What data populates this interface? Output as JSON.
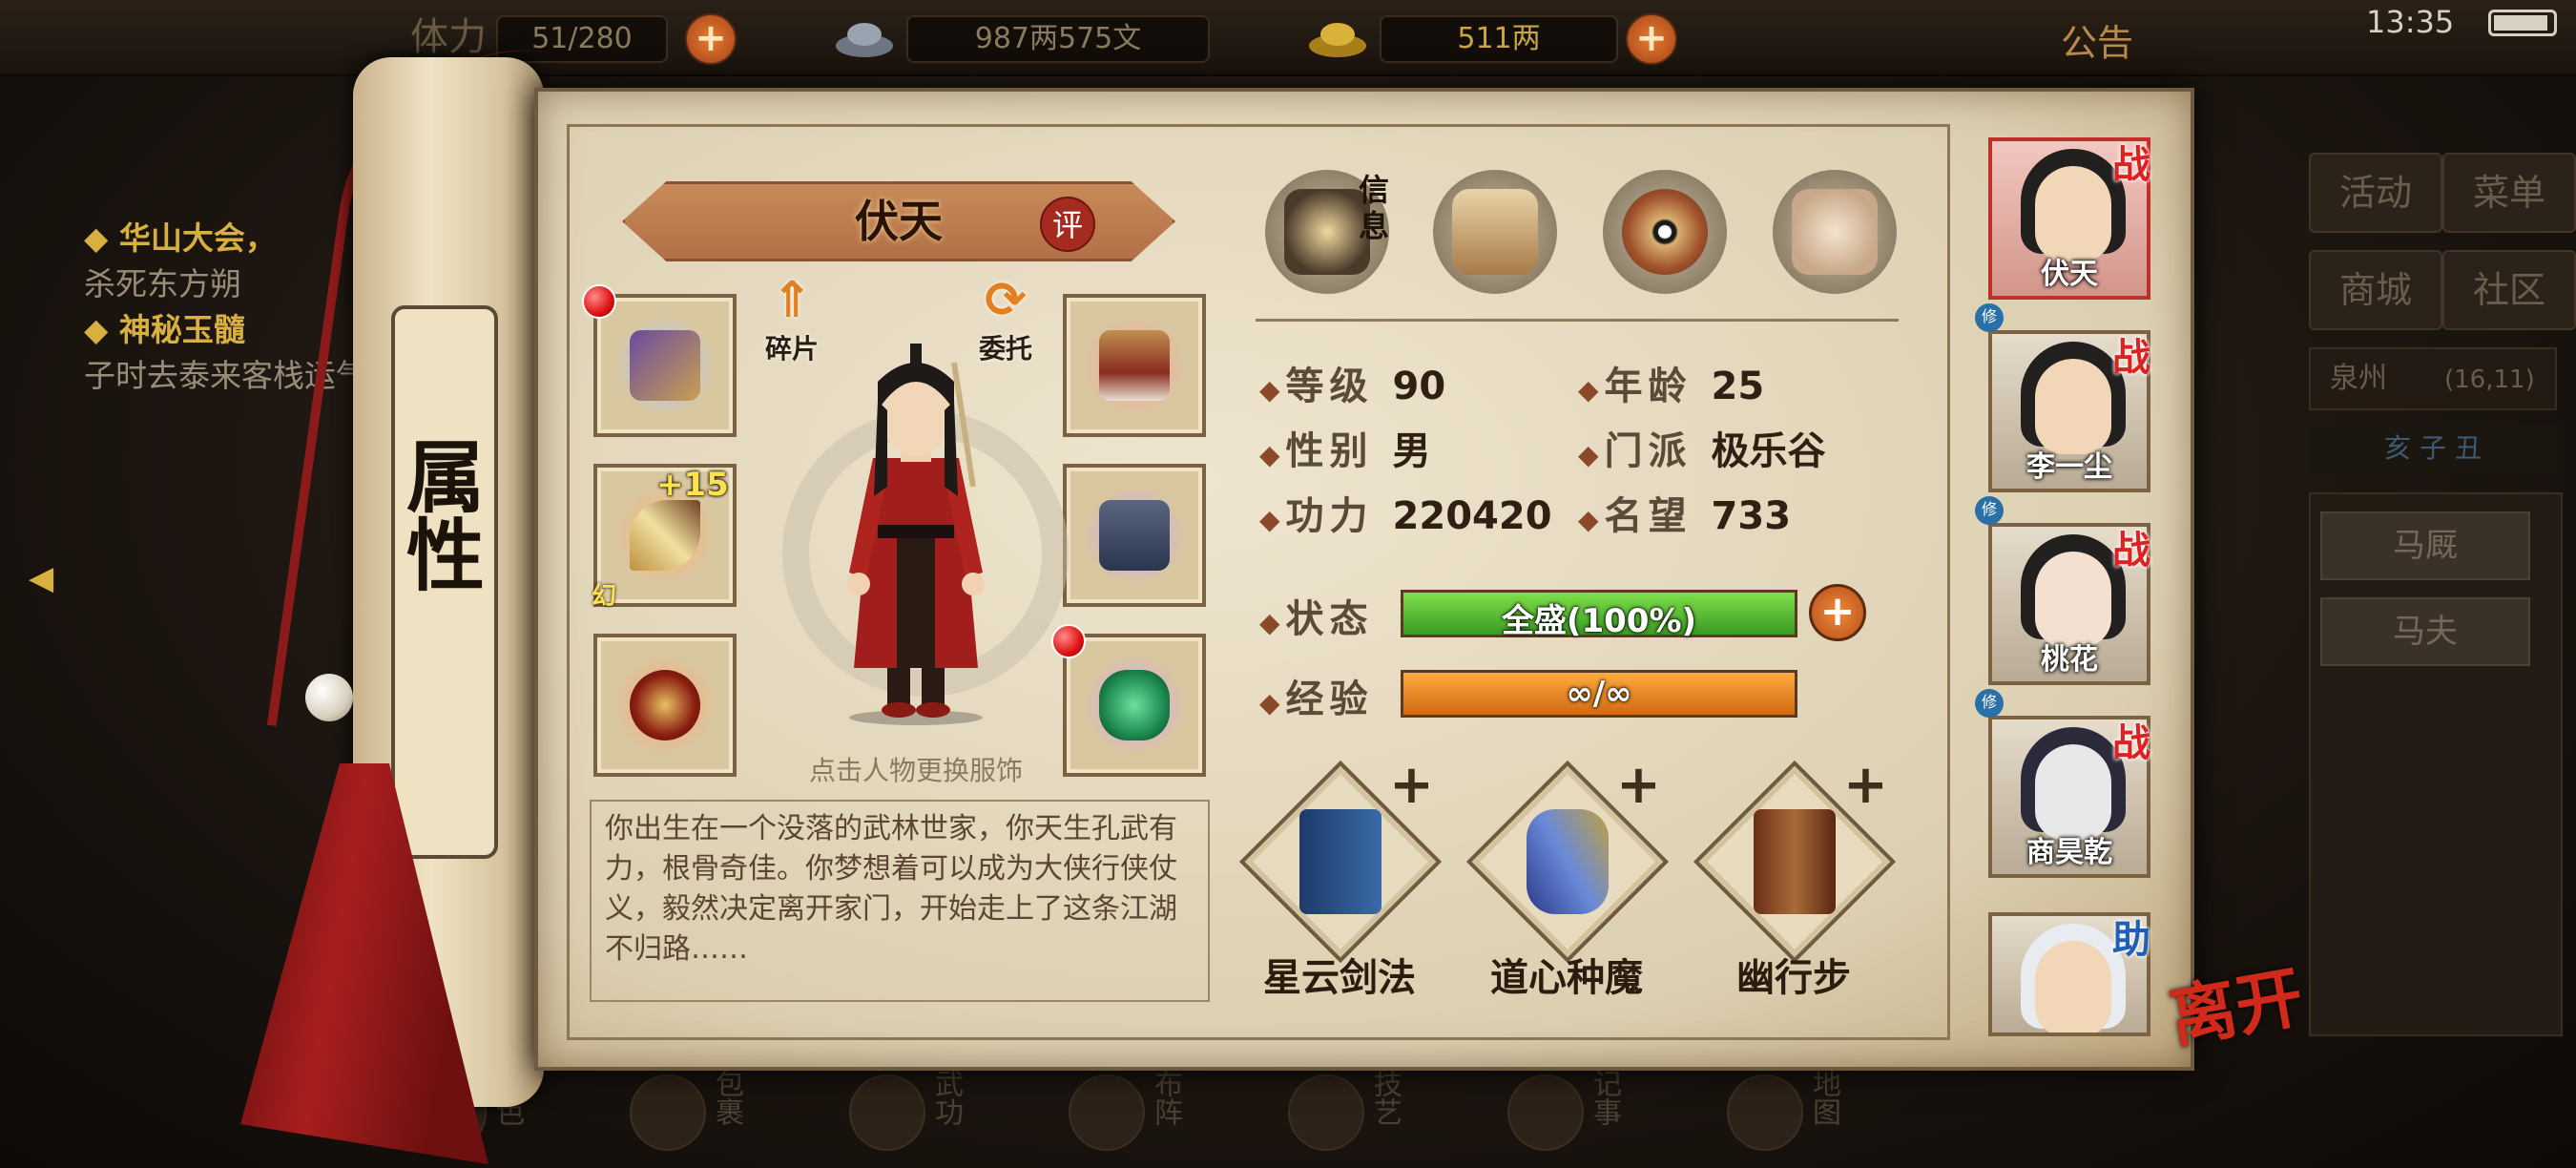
{
  "status_bar": {
    "time": "13:35"
  },
  "top_bar": {
    "stamina_label": "体力",
    "stamina": "51/280",
    "money": "987两575文",
    "gold": "511两",
    "announcement": "公告"
  },
  "quests": [
    {
      "title": "华山大会",
      "desc": "杀死东方朔"
    },
    {
      "title": "神秘玉髓",
      "desc": "子时去泰来客栈运气"
    }
  ],
  "right_menu": [
    "活动",
    "菜单",
    "商城",
    "社区"
  ],
  "location": {
    "name": "泉州",
    "coords": "(16,11)"
  },
  "time_bar": "亥 子 丑",
  "stalls": [
    "马厩",
    "马夫"
  ],
  "bottom_nav": [
    "角色",
    "包裹",
    "武功",
    "布阵",
    "技艺",
    "记事",
    "地图"
  ],
  "scroll_title": "属 性",
  "character": {
    "name": "伏天",
    "eval_label": "评",
    "shard_label": "碎片",
    "entrust_label": "委托",
    "hint": "点击人物更换服饰",
    "enhance": "+15",
    "illusion_tag": "幻",
    "bio": "你出生在一个没落的武林世家，你天生孔武有力，根骨奇佳。你梦想着可以成为大侠行侠仗义，毅然决定离开家门，开始走上了这条江湖不归路……"
  },
  "tabs": {
    "info_label": "信息"
  },
  "stats": {
    "level_label": "等级",
    "level": "90",
    "age_label": "年龄",
    "age": "25",
    "gender_label": "性别",
    "gender": "男",
    "sect_label": "门派",
    "sect": "极乐谷",
    "power_label": "功力",
    "power": "220420",
    "fame_label": "名望",
    "fame": "733",
    "state_label": "状态",
    "state": "全盛(100%)",
    "state_fraction": 1.0,
    "exp_label": "经验",
    "exp": "∞/∞",
    "exp_fraction": 1.0
  },
  "skills": [
    "星云剑法",
    "道心种魔",
    "幽行步"
  ],
  "party": [
    {
      "name": "伏天",
      "tag": "战",
      "selected": true
    },
    {
      "name": "李一尘",
      "tag": "战"
    },
    {
      "name": "桃花",
      "tag": "战"
    },
    {
      "name": "商昊乾",
      "tag": "战"
    },
    {
      "name": "",
      "tag": "助"
    }
  ],
  "xiu_label": "修",
  "leave_label": "离开",
  "colors": {
    "state_bar": "#4cb832",
    "exp_bar": "#e88416",
    "accent_red": "#c0302a"
  }
}
